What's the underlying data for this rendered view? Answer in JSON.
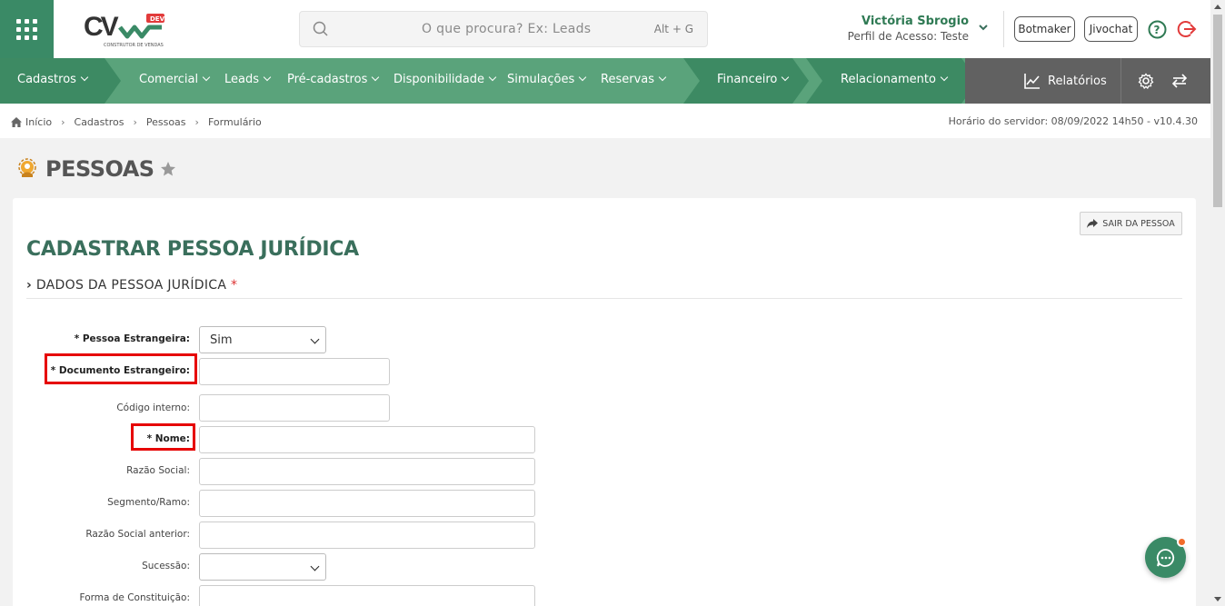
{
  "header": {
    "search_placeholder": "O que procura? Ex: Leads",
    "search_shortcut": "Alt + G",
    "user_name": "Victória Sbrogio",
    "user_profile": "Perfil de Acesso: Teste",
    "botmaker": "Botmaker",
    "jivochat": "Jivochat",
    "logo_text": "CV",
    "logo_badge": "DEV",
    "logo_sub": "CONSTRUTOR DE VENDAS"
  },
  "nav": {
    "items": [
      "Cadastros",
      "Comercial",
      "Leads",
      "Pré-cadastros",
      "Disponibilidade",
      "Simulações",
      "Reservas",
      "Financeiro",
      "Relacionamento"
    ],
    "reports": "Relatórios"
  },
  "breadcrumb": {
    "items": [
      "Início",
      "Cadastros",
      "Pessoas",
      "Formulário"
    ],
    "server_time": "Horário do servidor: 08/09/2022 14h50 - v10.4.30"
  },
  "page": {
    "title": "PESSOAS"
  },
  "form": {
    "exit_button": "SAIR DA PESSOA",
    "title": "CADASTRAR PESSOA JURÍDICA",
    "section": "DADOS DA PESSOA JURÍDICA",
    "section_required": "*",
    "fields": {
      "pessoa_estrangeira": {
        "label": "* Pessoa Estrangeira:",
        "value": "Sim"
      },
      "documento_estrangeiro": {
        "label": "* Documento Estrangeiro:",
        "value": ""
      },
      "codigo_interno": {
        "label": "Código interno:",
        "value": ""
      },
      "nome": {
        "label": "* Nome:",
        "value": ""
      },
      "razao_social": {
        "label": "Razão Social:",
        "value": ""
      },
      "segmento": {
        "label": "Segmento/Ramo:",
        "value": ""
      },
      "razao_social_anterior": {
        "label": "Razão Social anterior:",
        "value": ""
      },
      "sucessao": {
        "label": "Sucessão:",
        "value": ""
      },
      "forma_constituicao": {
        "label": "Forma de Constituição:",
        "value": ""
      }
    }
  },
  "colors": {
    "brand_green": "#3a8a66",
    "nav_green": "#5aa37b",
    "nav_dark": "#3d8a63",
    "title_green": "#3a6f5c",
    "highlight_red": "#e60000",
    "notification": "#f26b2a"
  }
}
